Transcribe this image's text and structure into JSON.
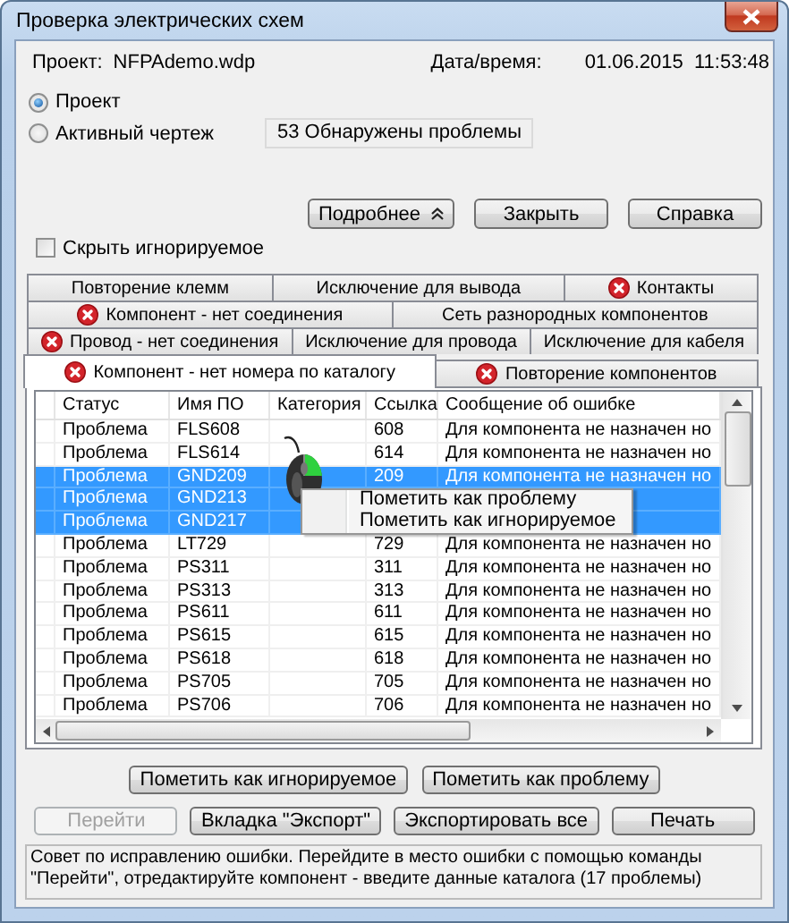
{
  "window": {
    "title": "Проверка электрических схем"
  },
  "project": {
    "label": "Проект:",
    "value": "NFPAdemo.wdp"
  },
  "datetime": {
    "label": "Дата/время:",
    "value": "01.06.2015  11:53:48"
  },
  "scope": [
    {
      "label": "Проект",
      "selected": true
    },
    {
      "label": "Активный чертеж",
      "selected": false
    }
  ],
  "summary": "53 Обнаружены проблемы",
  "top_buttons": [
    {
      "label": "Подробнее",
      "kind": "expander"
    },
    {
      "label": "Закрыть",
      "kind": "plain"
    },
    {
      "label": "Справка",
      "kind": "plain"
    }
  ],
  "hide_ignored": {
    "label": "Скрыть игнорируемое",
    "checked": false
  },
  "tab_rows": [
    [
      {
        "label": "Повторение клемм",
        "error": false,
        "selected": false
      },
      {
        "label": "Исключение для вывода",
        "error": false,
        "selected": false
      },
      {
        "label": "Контакты",
        "error": true,
        "selected": false
      }
    ],
    [
      {
        "label": "Компонент - нет соединения",
        "error": true,
        "selected": false
      },
      {
        "label": "Сеть разнородных компонентов",
        "error": false,
        "selected": false
      }
    ],
    [
      {
        "label": "Провод - нет соединения",
        "error": true,
        "selected": false
      },
      {
        "label": "Исключение для провода",
        "error": false,
        "selected": false
      },
      {
        "label": "Исключение для кабеля",
        "error": false,
        "selected": false
      }
    ],
    [
      {
        "label": "Компонент - нет номера по каталогу",
        "error": true,
        "selected": true
      },
      {
        "label": "Повторение компонентов",
        "error": true,
        "selected": false
      }
    ]
  ],
  "table": {
    "columns": [
      "Статус",
      "Имя ПО",
      "Категория",
      "Ссылка",
      "Сообщение об ошибке"
    ],
    "rows": [
      {
        "status": "Проблема",
        "name": "FLS608",
        "ref": "608",
        "message": "Для компонента не назначен но",
        "selected": false
      },
      {
        "status": "Проблема",
        "name": "FLS614",
        "ref": "614",
        "message": "Для компонента не назначен но",
        "selected": false
      },
      {
        "status": "Проблема",
        "name": "GND209",
        "ref": "209",
        "message": "Для компонента не назначен но",
        "selected": true
      },
      {
        "status": "Проблема",
        "name": "GND213",
        "selected": true
      },
      {
        "status": "Проблема",
        "name": "GND217",
        "selected": true
      },
      {
        "status": "Проблема",
        "name": "LT729",
        "ref": "729",
        "message": "Для компонента не назначен но",
        "selected": false
      },
      {
        "status": "Проблема",
        "name": "PS311",
        "ref": "311",
        "message": "Для компонента не назначен но",
        "selected": false
      },
      {
        "status": "Проблема",
        "name": "PS313",
        "ref": "313",
        "message": "Для компонента не назначен но",
        "selected": false
      },
      {
        "status": "Проблема",
        "name": "PS611",
        "ref": "611",
        "message": "Для компонента не назначен но",
        "selected": false
      },
      {
        "status": "Проблема",
        "name": "PS615",
        "ref": "615",
        "message": "Для компонента не назначен но",
        "selected": false
      },
      {
        "status": "Проблема",
        "name": "PS618",
        "ref": "618",
        "message": "Для компонента не назначен но",
        "selected": false
      },
      {
        "status": "Проблема",
        "name": "PS705",
        "ref": "705",
        "message": "Для компонента не назначен но",
        "selected": false
      },
      {
        "status": "Проблема",
        "name": "PS706",
        "ref": "706",
        "message": "Для компонента не назначен но",
        "selected": false
      }
    ]
  },
  "context_menu": [
    "Пометить как проблему",
    "Пометить как игнорируемое"
  ],
  "mark_buttons": [
    {
      "label": "Пометить как игнорируемое",
      "disabled": false
    },
    {
      "label": "Пометить как проблему",
      "disabled": false
    }
  ],
  "action_buttons": [
    {
      "label": "Перейти",
      "disabled": true
    },
    {
      "label": "Вкладка \"Экспорт\"",
      "disabled": false
    },
    {
      "label": "Экспортировать все",
      "disabled": false
    },
    {
      "label": "Печать",
      "disabled": false
    }
  ],
  "hint": "Совет по исправлению ошибки. Перейдите в место ошибки с помощью команды \"Перейти\", отредактируйте компонент - введите данные каталога (17 проблемы)"
}
